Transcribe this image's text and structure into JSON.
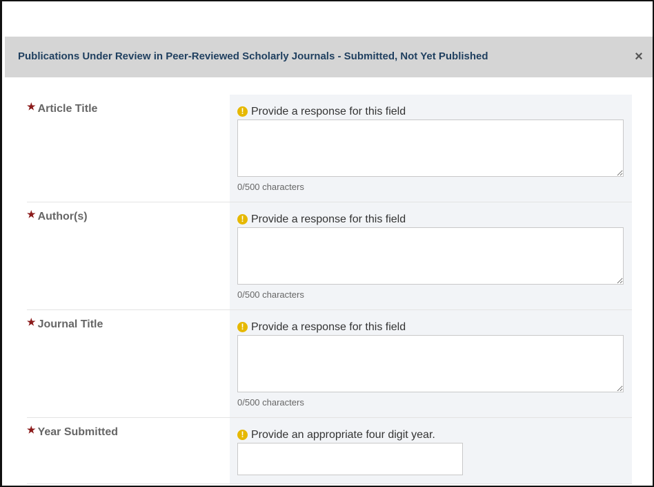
{
  "dialog": {
    "title": "Publications Under Review in Peer-Reviewed Scholarly Journals - Submitted, Not Yet Published",
    "close_label": "×"
  },
  "fields": [
    {
      "label": "Article Title",
      "warning": "Provide a response for this field",
      "value": "",
      "count": "0/500 characters"
    },
    {
      "label": "Author(s)",
      "warning": "Provide a response for this field",
      "value": "",
      "count": "0/500 characters"
    },
    {
      "label": "Journal Title",
      "warning": "Provide a response for this field",
      "value": "",
      "count": "0/500 characters"
    },
    {
      "label": "Year Submitted",
      "warning": "Provide an appropriate four digit year.",
      "value": ""
    }
  ],
  "icons": {
    "required": "asterisk-icon",
    "warning": "exclamation-circle-icon"
  },
  "colors": {
    "header_bg": "#d5d5d5",
    "title": "#1f3f5f",
    "required_star": "#8b1a1a",
    "warning_icon": "#e6b800"
  }
}
